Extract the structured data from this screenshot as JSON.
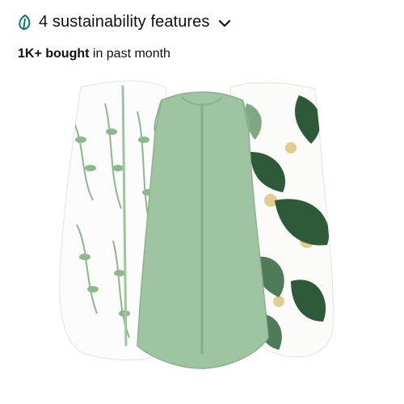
{
  "sustainability": {
    "label": "4 sustainability features",
    "icon": "leaf-icon",
    "expand_icon": "chevron-down-icon",
    "accent_color": "#067d62"
  },
  "sales": {
    "count": "1K+ bought",
    "suffix": " in past month"
  },
  "product_image": {
    "colors": {
      "sage": "#9fc4a2",
      "leaf_light": "#8bb98a",
      "leaf_dark": "#2f5a3a",
      "gold": "#e3cc8f"
    }
  }
}
